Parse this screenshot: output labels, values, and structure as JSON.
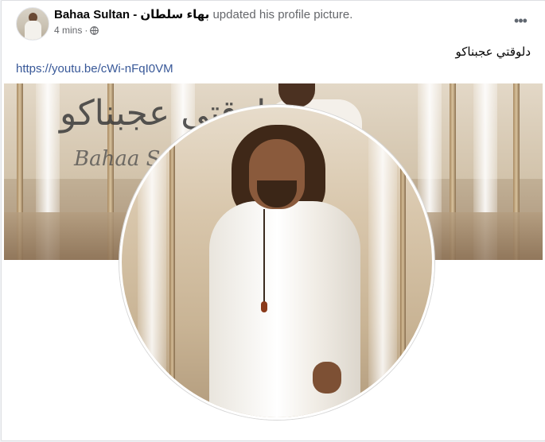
{
  "post": {
    "author": "Bahaa Sultan - بهاء سلطان",
    "action": "updated his profile picture.",
    "time": "4 mins",
    "separator": "·",
    "more_label": "•••",
    "caption": "دلوقتي عجبناكو",
    "link": "https://youtu.be/cWi-nFqI0VM"
  },
  "cover": {
    "title_ar": "دلوقتي عجبناكو",
    "title_en": "Bahaa Sultan"
  },
  "icons": {
    "audience": "globe-icon",
    "menu": "more-horizontal-icon"
  },
  "colors": {
    "link": "#385898",
    "meta": "#65676b",
    "text": "#050505"
  }
}
